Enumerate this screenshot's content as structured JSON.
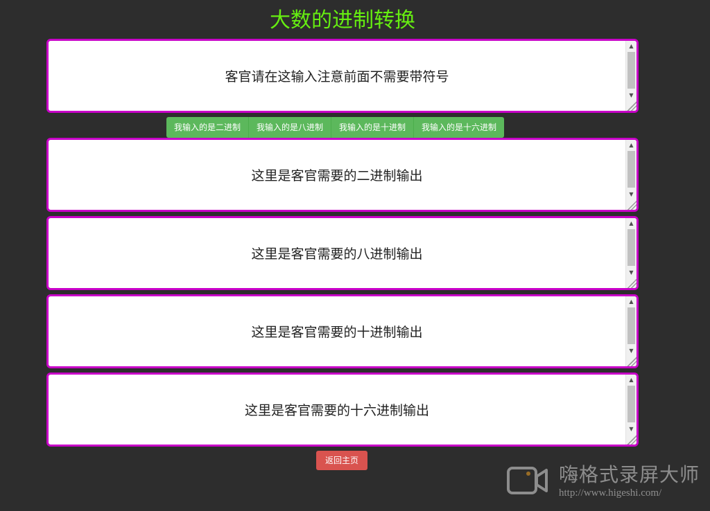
{
  "page": {
    "title": "大数的进制转换"
  },
  "input": {
    "placeholder": "客官请在这输入注意前面不需要带符号"
  },
  "buttons": [
    {
      "label": "我输入的是二进制"
    },
    {
      "label": "我输入的是八进制"
    },
    {
      "label": "我输入的是十进制"
    },
    {
      "label": "我输入的是十六进制"
    }
  ],
  "outputs": [
    {
      "placeholder": "这里是客官需要的二进制输出"
    },
    {
      "placeholder": "这里是客官需要的八进制输出"
    },
    {
      "placeholder": "这里是客官需要的十进制输出"
    },
    {
      "placeholder": "这里是客官需要的十六进制输出"
    }
  ],
  "back_button": {
    "label": "返回主页"
  },
  "watermark": {
    "brand": "嗨格式录屏大师",
    "url": "http://www.higeshi.com/"
  },
  "icons": {
    "scroll_up": "scroll-up-arrow-icon",
    "scroll_down": "scroll-down-arrow-icon",
    "resize": "resize-grip-icon",
    "camera": "camera-icon"
  },
  "colors": {
    "background": "#2d2d2d",
    "title": "#66ee11",
    "box_border": "#c800c8",
    "button_green": "#5cb85c",
    "button_red": "#d9534f"
  }
}
